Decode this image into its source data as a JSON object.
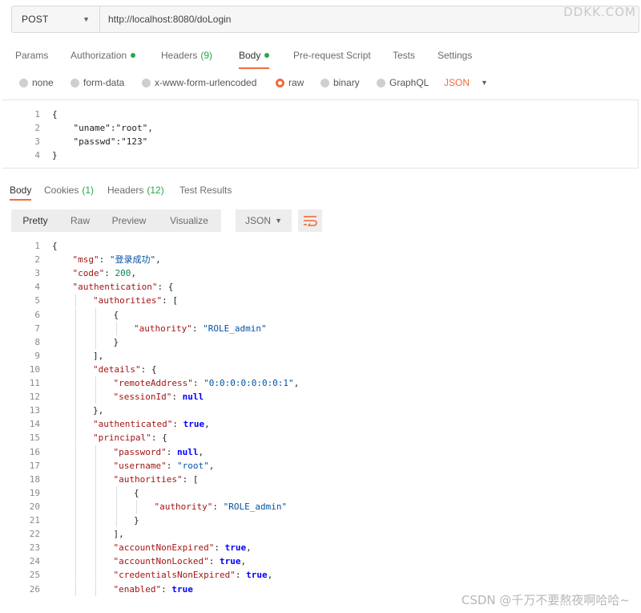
{
  "request": {
    "method": "POST",
    "url": "http://localhost:8080/doLogin"
  },
  "watermark_top": "DDKK.COM",
  "watermark_bottom": "CSDN @千万不要熬夜啊哈哈~",
  "request_tabs": [
    {
      "label": "Params"
    },
    {
      "label": "Authorization",
      "dot": true
    },
    {
      "label": "Headers",
      "count": "(9)"
    },
    {
      "label": "Body",
      "dot": true,
      "active": true
    },
    {
      "label": "Pre-request Script"
    },
    {
      "label": "Tests"
    },
    {
      "label": "Settings"
    }
  ],
  "body_options": [
    {
      "label": "none"
    },
    {
      "label": "form-data"
    },
    {
      "label": "x-www-form-urlencoded"
    },
    {
      "label": "raw",
      "selected": true
    },
    {
      "label": "binary"
    },
    {
      "label": "GraphQL"
    }
  ],
  "body_format": "JSON",
  "request_body_lines": [
    "{",
    "    \"uname\":\"root\",",
    "    \"passwd\":\"123\"",
    "}"
  ],
  "response_tabs": [
    {
      "label": "Body",
      "active": true
    },
    {
      "label": "Cookies",
      "count": "(1)"
    },
    {
      "label": "Headers",
      "count": "(12)"
    },
    {
      "label": "Test Results"
    }
  ],
  "response_toolbar": {
    "buttons": [
      "Pretty",
      "Raw",
      "Preview",
      "Visualize"
    ],
    "format": "JSON"
  },
  "response_lines": [
    {
      "indent": 0,
      "tokens": [
        [
          "p",
          "{"
        ]
      ]
    },
    {
      "indent": 1,
      "tokens": [
        [
          "k",
          "\"msg\""
        ],
        [
          "p",
          ": "
        ],
        [
          "s",
          "\"登录成功\""
        ],
        [
          "p",
          ","
        ]
      ]
    },
    {
      "indent": 1,
      "tokens": [
        [
          "k",
          "\"code\""
        ],
        [
          "p",
          ": "
        ],
        [
          "n",
          "200"
        ],
        [
          "p",
          ","
        ]
      ]
    },
    {
      "indent": 1,
      "tokens": [
        [
          "k",
          "\"authentication\""
        ],
        [
          "p",
          ": {"
        ]
      ]
    },
    {
      "indent": 2,
      "tokens": [
        [
          "k",
          "\"authorities\""
        ],
        [
          "p",
          ": ["
        ]
      ]
    },
    {
      "indent": 3,
      "tokens": [
        [
          "p",
          "{"
        ]
      ]
    },
    {
      "indent": 4,
      "tokens": [
        [
          "k",
          "\"authority\""
        ],
        [
          "p",
          ": "
        ],
        [
          "s",
          "\"ROLE_admin\""
        ]
      ]
    },
    {
      "indent": 3,
      "tokens": [
        [
          "p",
          "}"
        ]
      ]
    },
    {
      "indent": 2,
      "tokens": [
        [
          "p",
          "],"
        ]
      ]
    },
    {
      "indent": 2,
      "tokens": [
        [
          "k",
          "\"details\""
        ],
        [
          "p",
          ": {"
        ]
      ]
    },
    {
      "indent": 3,
      "tokens": [
        [
          "k",
          "\"remoteAddress\""
        ],
        [
          "p",
          ": "
        ],
        [
          "s",
          "\"0:0:0:0:0:0:0:1\""
        ],
        [
          "p",
          ","
        ]
      ]
    },
    {
      "indent": 3,
      "tokens": [
        [
          "k",
          "\"sessionId\""
        ],
        [
          "p",
          ": "
        ],
        [
          "kw",
          "null"
        ]
      ]
    },
    {
      "indent": 2,
      "tokens": [
        [
          "p",
          "},"
        ]
      ]
    },
    {
      "indent": 2,
      "tokens": [
        [
          "k",
          "\"authenticated\""
        ],
        [
          "p",
          ": "
        ],
        [
          "kw",
          "true"
        ],
        [
          "p",
          ","
        ]
      ]
    },
    {
      "indent": 2,
      "tokens": [
        [
          "k",
          "\"principal\""
        ],
        [
          "p",
          ": {"
        ]
      ]
    },
    {
      "indent": 3,
      "tokens": [
        [
          "k",
          "\"password\""
        ],
        [
          "p",
          ": "
        ],
        [
          "kw",
          "null"
        ],
        [
          "p",
          ","
        ]
      ]
    },
    {
      "indent": 3,
      "tokens": [
        [
          "k",
          "\"username\""
        ],
        [
          "p",
          ": "
        ],
        [
          "s",
          "\"root\""
        ],
        [
          "p",
          ","
        ]
      ]
    },
    {
      "indent": 3,
      "tokens": [
        [
          "k",
          "\"authorities\""
        ],
        [
          "p",
          ": ["
        ]
      ]
    },
    {
      "indent": 4,
      "tokens": [
        [
          "p",
          "{"
        ]
      ]
    },
    {
      "indent": 5,
      "tokens": [
        [
          "k",
          "\"authority\""
        ],
        [
          "p",
          ": "
        ],
        [
          "s",
          "\"ROLE_admin\""
        ]
      ]
    },
    {
      "indent": 4,
      "tokens": [
        [
          "p",
          "}"
        ]
      ]
    },
    {
      "indent": 3,
      "tokens": [
        [
          "p",
          "],"
        ]
      ]
    },
    {
      "indent": 3,
      "tokens": [
        [
          "k",
          "\"accountNonExpired\""
        ],
        [
          "p",
          ": "
        ],
        [
          "kw",
          "true"
        ],
        [
          "p",
          ","
        ]
      ]
    },
    {
      "indent": 3,
      "tokens": [
        [
          "k",
          "\"accountNonLocked\""
        ],
        [
          "p",
          ": "
        ],
        [
          "kw",
          "true"
        ],
        [
          "p",
          ","
        ]
      ]
    },
    {
      "indent": 3,
      "tokens": [
        [
          "k",
          "\"credentialsNonExpired\""
        ],
        [
          "p",
          ": "
        ],
        [
          "kw",
          "true"
        ],
        [
          "p",
          ","
        ]
      ]
    },
    {
      "indent": 3,
      "tokens": [
        [
          "k",
          "\"enabled\""
        ],
        [
          "p",
          ": "
        ],
        [
          "kw",
          "true"
        ]
      ]
    }
  ]
}
